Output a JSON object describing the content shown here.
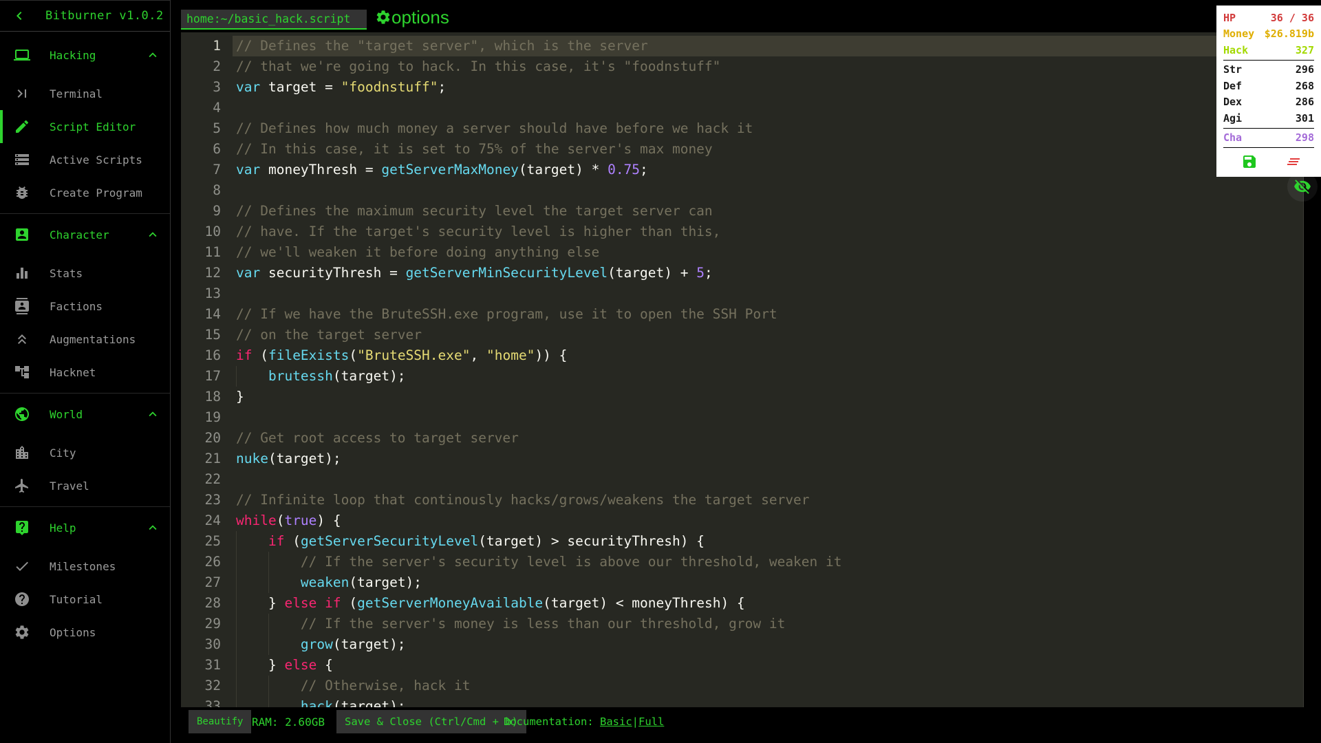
{
  "app": {
    "title": "Bitburner v1.0.2",
    "green": "#2ed32e"
  },
  "sidebar": {
    "back_icon": "chevron-left-icon",
    "sections": [
      {
        "label": "Hacking",
        "icon": "laptop-icon",
        "expanded": true,
        "items": [
          {
            "label": "Terminal",
            "icon": "terminal-icon",
            "active": false
          },
          {
            "label": "Script Editor",
            "icon": "pencil-icon",
            "active": true
          },
          {
            "label": "Active Scripts",
            "icon": "storage-icon",
            "active": false
          },
          {
            "label": "Create Program",
            "icon": "bug-icon",
            "active": false
          }
        ]
      },
      {
        "label": "Character",
        "icon": "person-badge-icon",
        "expanded": true,
        "items": [
          {
            "label": "Stats",
            "icon": "bar-chart-icon",
            "active": false
          },
          {
            "label": "Factions",
            "icon": "contacts-icon",
            "active": false
          },
          {
            "label": "Augmentations",
            "icon": "double-arrow-up-icon",
            "active": false
          },
          {
            "label": "Hacknet",
            "icon": "network-tree-icon",
            "active": false
          }
        ]
      },
      {
        "label": "World",
        "icon": "globe-icon",
        "expanded": true,
        "items": [
          {
            "label": "City",
            "icon": "city-icon",
            "active": false
          },
          {
            "label": "Travel",
            "icon": "airplane-icon",
            "active": false
          }
        ]
      },
      {
        "label": "Help",
        "icon": "help-bubble-icon",
        "expanded": true,
        "items": [
          {
            "label": "Milestones",
            "icon": "check-icon",
            "active": false
          },
          {
            "label": "Tutorial",
            "icon": "help-circle-icon",
            "active": false
          },
          {
            "label": "Options",
            "icon": "gear-icon",
            "active": false
          }
        ]
      }
    ]
  },
  "editor": {
    "tab_label": "home:~/basic_hack.script",
    "options_label": "options",
    "options_icon": "gear-icon",
    "active_line": 1,
    "lines": [
      [
        [
          "c",
          "// Defines the \"target server\", which is the server"
        ]
      ],
      [
        [
          "c",
          "// that we're going to hack. In this case, it's \"foodnstuff\""
        ]
      ],
      [
        [
          "f",
          "var"
        ],
        [
          "p",
          " target = "
        ],
        [
          "s",
          "\"foodnstuff\""
        ],
        [
          "p",
          ";"
        ]
      ],
      [],
      [
        [
          "c",
          "// Defines how much money a server should have before we hack it"
        ]
      ],
      [
        [
          "c",
          "// In this case, it is set to 75% of the server's max money"
        ]
      ],
      [
        [
          "f",
          "var"
        ],
        [
          "p",
          " moneyThresh = "
        ],
        [
          "f",
          "getServerMaxMoney"
        ],
        [
          "p",
          "(target) * "
        ],
        [
          "n",
          "0.75"
        ],
        [
          "p",
          ";"
        ]
      ],
      [],
      [
        [
          "c",
          "// Defines the maximum security level the target server can"
        ]
      ],
      [
        [
          "c",
          "// have. If the target's security level is higher than this,"
        ]
      ],
      [
        [
          "c",
          "// we'll weaken it before doing anything else"
        ]
      ],
      [
        [
          "f",
          "var"
        ],
        [
          "p",
          " securityThresh = "
        ],
        [
          "f",
          "getServerMinSecurityLevel"
        ],
        [
          "p",
          "(target) + "
        ],
        [
          "n",
          "5"
        ],
        [
          "p",
          ";"
        ]
      ],
      [],
      [
        [
          "c",
          "// If we have the BruteSSH.exe program, use it to open the SSH Port"
        ]
      ],
      [
        [
          "c",
          "// on the target server"
        ]
      ],
      [
        [
          "k",
          "if"
        ],
        [
          "p",
          " ("
        ],
        [
          "f",
          "fileExists"
        ],
        [
          "p",
          "("
        ],
        [
          "s",
          "\"BruteSSH.exe\""
        ],
        [
          "p",
          ", "
        ],
        [
          "s",
          "\"home\""
        ],
        [
          "p",
          ")) {"
        ]
      ],
      [
        [
          "p",
          "    "
        ],
        [
          "f",
          "brutessh"
        ],
        [
          "p",
          "(target);"
        ]
      ],
      [
        [
          "p",
          "}"
        ]
      ],
      [],
      [
        [
          "c",
          "// Get root access to target server"
        ]
      ],
      [
        [
          "f",
          "nuke"
        ],
        [
          "p",
          "(target);"
        ]
      ],
      [],
      [
        [
          "c",
          "// Infinite loop that continously hacks/grows/weakens the target server"
        ]
      ],
      [
        [
          "k",
          "while"
        ],
        [
          "p",
          "("
        ],
        [
          "n",
          "true"
        ],
        [
          "p",
          ") {"
        ]
      ],
      [
        [
          "p",
          "    "
        ],
        [
          "k",
          "if"
        ],
        [
          "p",
          " ("
        ],
        [
          "f",
          "getServerSecurityLevel"
        ],
        [
          "p",
          "(target) > securityThresh) {"
        ]
      ],
      [
        [
          "p",
          "        "
        ],
        [
          "c",
          "// If the server's security level is above our threshold, weaken it"
        ]
      ],
      [
        [
          "p",
          "        "
        ],
        [
          "f",
          "weaken"
        ],
        [
          "p",
          "(target);"
        ]
      ],
      [
        [
          "p",
          "    } "
        ],
        [
          "k",
          "else"
        ],
        [
          "p",
          " "
        ],
        [
          "k",
          "if"
        ],
        [
          "p",
          " ("
        ],
        [
          "f",
          "getServerMoneyAvailable"
        ],
        [
          "p",
          "(target) < moneyThresh) {"
        ]
      ],
      [
        [
          "p",
          "        "
        ],
        [
          "c",
          "// If the server's money is less than our threshold, grow it"
        ]
      ],
      [
        [
          "p",
          "        "
        ],
        [
          "f",
          "grow"
        ],
        [
          "p",
          "(target);"
        ]
      ],
      [
        [
          "p",
          "    } "
        ],
        [
          "k",
          "else"
        ],
        [
          "p",
          " {"
        ]
      ],
      [
        [
          "p",
          "        "
        ],
        [
          "c",
          "// Otherwise, hack it"
        ]
      ],
      [
        [
          "p",
          "        "
        ],
        [
          "f",
          "hack"
        ],
        [
          "p",
          "(target);"
        ]
      ]
    ]
  },
  "bottombar": {
    "beautify_label": "Beautify",
    "ram_label": "RAM: 2.60GB",
    "save_label": "Save & Close (Ctrl/Cmd + b)",
    "documentation_label": "Documentation:",
    "doc_basic_label": "Basic",
    "doc_separator": " |",
    "doc_full_label": "Full"
  },
  "overview": {
    "stats": [
      {
        "label": "HP",
        "value": "36 / 36",
        "color": "hp",
        "divider_after": false
      },
      {
        "label": "Money",
        "value": "$26.819b",
        "color": "money",
        "divider_after": false
      },
      {
        "label": "Hack",
        "value": "327",
        "color": "hack",
        "divider_after": true
      },
      {
        "label": "Str",
        "value": "296",
        "color": "plain",
        "divider_after": false
      },
      {
        "label": "Def",
        "value": "268",
        "color": "plain",
        "divider_after": false
      },
      {
        "label": "Dex",
        "value": "286",
        "color": "plain",
        "divider_after": false
      },
      {
        "label": "Agi",
        "value": "301",
        "color": "plain",
        "divider_after": true
      },
      {
        "label": "Cha",
        "value": "298",
        "color": "cha",
        "divider_after": true
      }
    ],
    "icons": [
      {
        "name": "save-icon",
        "color": "#1ec71e"
      },
      {
        "name": "clear-all-icon",
        "color": "#e33e3e"
      }
    ],
    "visibility_icon": "eye-off-icon"
  }
}
